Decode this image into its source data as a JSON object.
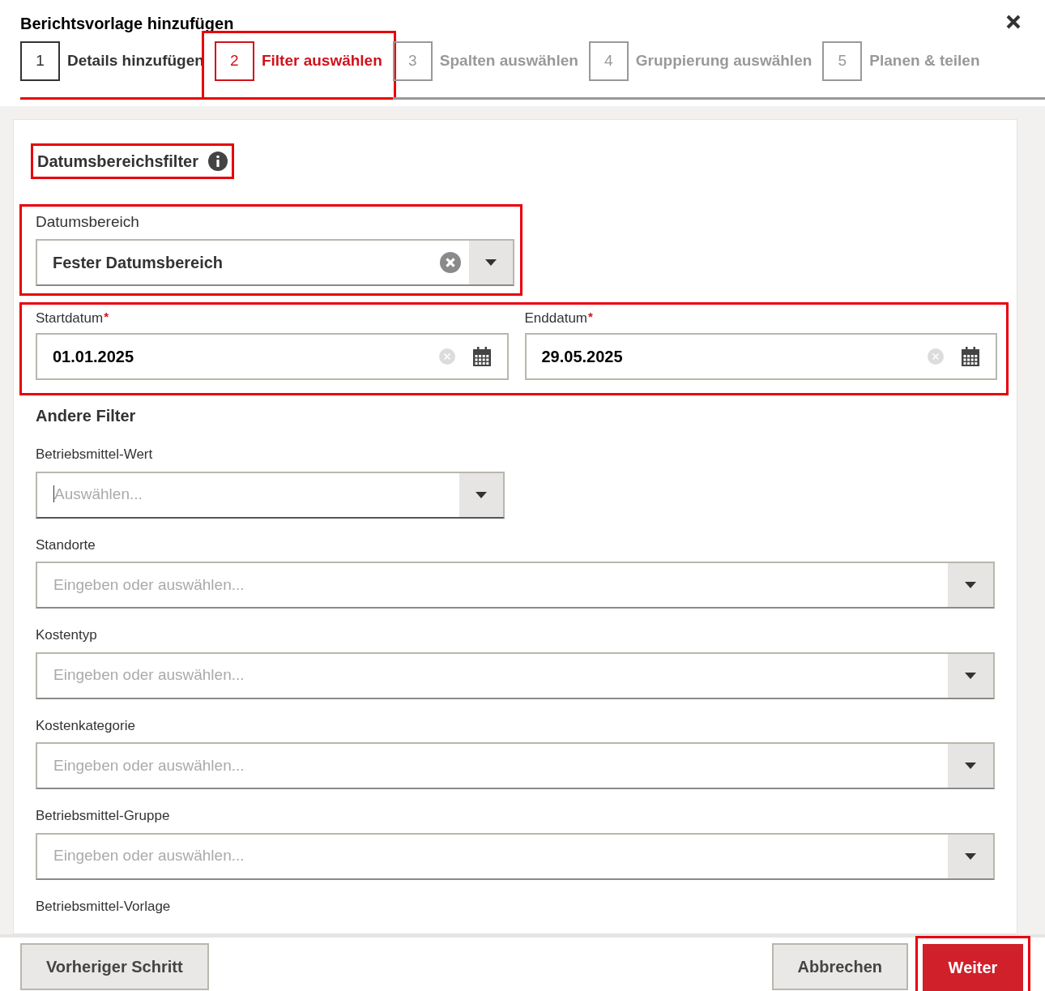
{
  "dialog": {
    "title": "Berichtsvorlage hinzufügen"
  },
  "steps": [
    {
      "number": "1",
      "label": "Details hinzufügen",
      "completed": true,
      "selected": false,
      "highlighted": false
    },
    {
      "number": "2",
      "label": "Filter auswählen",
      "completed": false,
      "selected": true,
      "highlighted": true
    },
    {
      "number": "3",
      "label": "Spalten auswählen",
      "completed": false,
      "selected": false,
      "highlighted": false
    },
    {
      "number": "4",
      "label": "Gruppierung auswählen",
      "completed": false,
      "selected": false,
      "highlighted": false
    },
    {
      "number": "5",
      "label": "Planen & teilen",
      "completed": false,
      "selected": false,
      "highlighted": false
    }
  ],
  "date_filter": {
    "heading": "Datumsbereichsfilter",
    "heading_highlighted": true,
    "range": {
      "label": "Datumsbereich",
      "value": "Fester Datumsbereich",
      "highlighted": true
    },
    "dates_highlighted": true,
    "dates": [
      {
        "label": "Startdatum",
        "required_mark": "*",
        "value": "01.01.2025"
      },
      {
        "label": "Enddatum",
        "required_mark": "*",
        "value": "29.05.2025"
      }
    ]
  },
  "other_filters": {
    "heading": "Andere Filter",
    "fields": [
      {
        "kind": "select",
        "label": "Betriebsmittel-Wert",
        "placeholder": "Auswählen..."
      },
      {
        "kind": "combo",
        "label": "Standorte",
        "placeholder": "Eingeben oder auswählen..."
      },
      {
        "kind": "combo",
        "label": "Kostentyp",
        "placeholder": "Eingeben oder auswählen..."
      },
      {
        "kind": "combo",
        "label": "Kostenkategorie",
        "placeholder": "Eingeben oder auswählen..."
      },
      {
        "kind": "combo",
        "label": "Betriebsmittel-Gruppe",
        "placeholder": "Eingeben oder auswählen..."
      },
      {
        "kind": "combo",
        "label": "Betriebsmittel-Vorlage"
      }
    ]
  },
  "footer": {
    "back": "Vorheriger Schritt",
    "cancel": "Abbrechen",
    "next": "Weiter",
    "next_highlighted": true
  }
}
